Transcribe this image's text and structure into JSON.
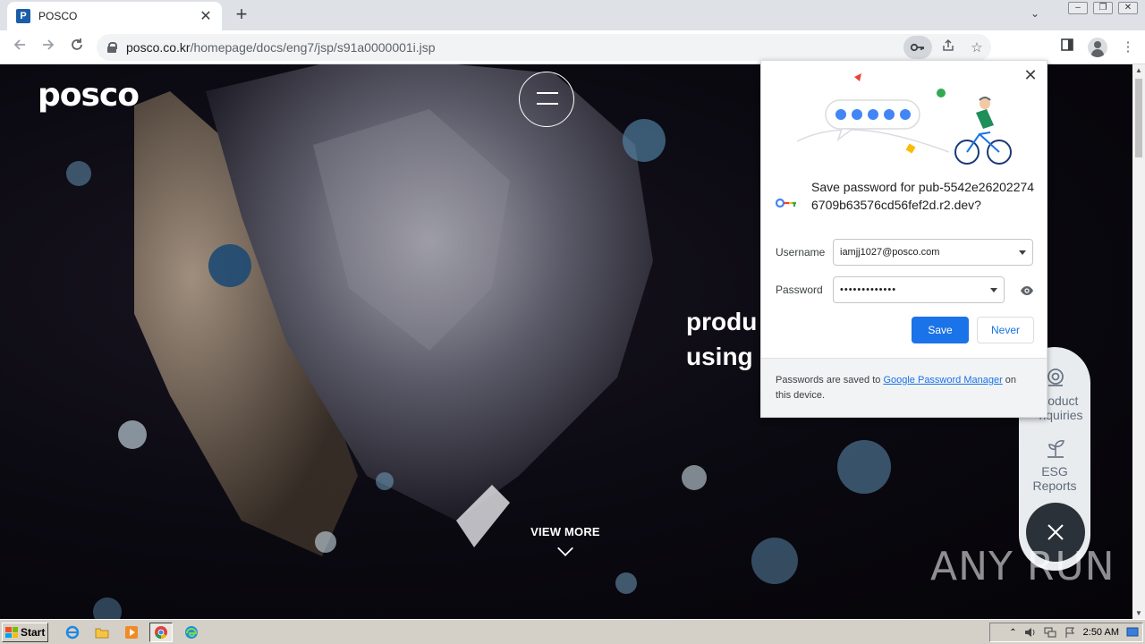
{
  "browser": {
    "tab_title": "POSCO",
    "tab_favicon": "P",
    "url_host": "posco.co.kr",
    "url_path": "/homepage/docs/eng7/jsp/s91a0000001i.jsp"
  },
  "page": {
    "logo": "posco",
    "hero_text": "produ\nusing",
    "view_more": "VIEW MORE",
    "side_panel": {
      "item1": "roduct\nnquiries",
      "item2": "ESG\nReports"
    },
    "watermark": "ANY RUN"
  },
  "password_popup": {
    "title": "Save password for pub-5542e262022746709b63576cd56fef2d.r2.dev?",
    "username_label": "Username",
    "username_value": "iamjj1027@posco.com",
    "password_label": "Password",
    "password_value": "•••••••••••••",
    "save_label": "Save",
    "never_label": "Never",
    "footer_prefix": "Passwords are saved to ",
    "footer_link": "Google Password Manager",
    "footer_suffix": " on this device."
  },
  "taskbar": {
    "start_label": "Start",
    "clock": "2:50 AM"
  },
  "icons": [
    "lock-icon",
    "key-icon",
    "share-icon",
    "star-icon",
    "sidebar-icon",
    "profile-icon",
    "menu-icon",
    "eye-icon",
    "close-icon"
  ],
  "colors": {
    "accent": "#1a73e8",
    "taskbar": "#d4d0c8",
    "page_bg": "#0c0a12"
  }
}
